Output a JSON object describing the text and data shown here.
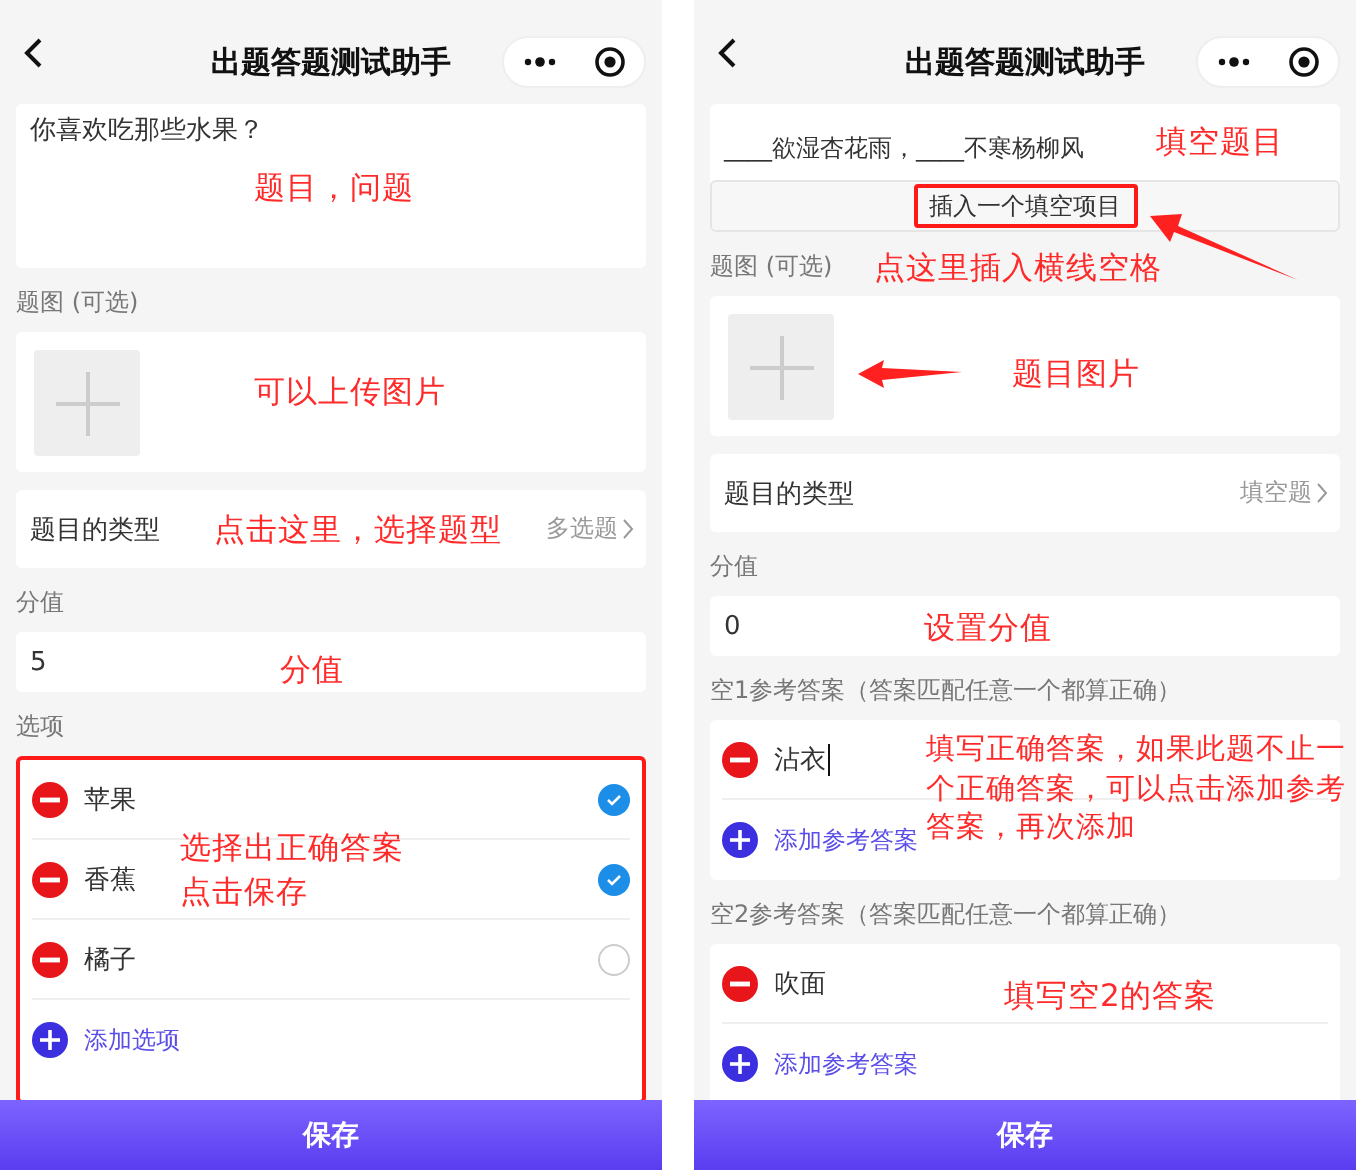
{
  "screens": [
    {
      "title": "出题答题测试助手",
      "save": "保存",
      "sections": [
        {
          "kind": "question",
          "text": "你喜欢吃那些水果？"
        },
        {
          "kind": "image",
          "label": "题图 (可选)"
        },
        {
          "kind": "type",
          "label": "题目的类型",
          "value": "多选题"
        },
        {
          "kind": "score",
          "label": "分值",
          "value": "5"
        },
        {
          "kind": "options",
          "label": "选项",
          "highlighted": true,
          "add": "添加选项",
          "items": [
            {
              "text": "苹果",
              "selected": true
            },
            {
              "text": "香蕉",
              "selected": true
            },
            {
              "text": "橘子",
              "selected": false
            }
          ]
        }
      ],
      "annotations": [
        "题目，问题",
        "可以上传图片",
        "点击这里，选择题型",
        "分值",
        "选择出正确答案",
        "点击保存"
      ]
    },
    {
      "title": "出题答题测试助手",
      "save": "保存",
      "sections": [
        {
          "kind": "blank_question",
          "text": "____欲湿杏花雨，____不寒杨柳风",
          "insert": "插入一个填空项目",
          "highlighted": true
        },
        {
          "kind": "image",
          "label": "题图 (可选)"
        },
        {
          "kind": "type",
          "label": "题目的类型",
          "value": "填空题"
        },
        {
          "kind": "score",
          "label": "分值",
          "value": "0"
        },
        {
          "kind": "answers",
          "label": "空1参考答案（答案匹配任意一个都算正确）",
          "add": "添加参考答案",
          "items": [
            {
              "text": "沾衣",
              "cursor": true
            }
          ]
        },
        {
          "kind": "answers",
          "label": "空2参考答案（答案匹配任意一个都算正确）",
          "add": "添加参考答案",
          "items": [
            {
              "text": "吹面",
              "cursor": false
            }
          ]
        }
      ],
      "annotations": [
        "填空题目",
        "点这里插入横线空格",
        "题目图片",
        "设置分值",
        "填写正确答案，如果此题不止一个正确答案，可以点击添加参考答案，再次添加",
        "填写空2的答案"
      ]
    }
  ]
}
